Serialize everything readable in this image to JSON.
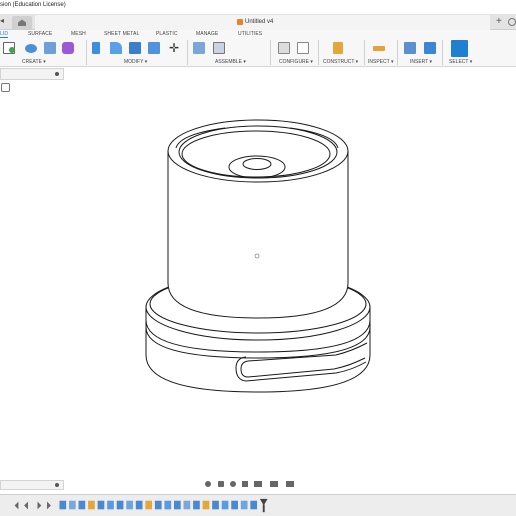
{
  "app": {
    "title": "sion (Education License)",
    "document_title": "Untitled v4"
  },
  "ribbon": {
    "tabs": [
      {
        "label": "LID",
        "active": true
      },
      {
        "label": "SURFACE",
        "active": false
      },
      {
        "label": "MESH",
        "active": false
      },
      {
        "label": "SHEET METAL",
        "active": false
      },
      {
        "label": "PLASTIC",
        "active": false
      },
      {
        "label": "MANAGE",
        "active": false
      },
      {
        "label": "UTILITIES",
        "active": false
      }
    ],
    "groups": [
      {
        "label": "CREATE ▾"
      },
      {
        "label": "MODIFY ▾"
      },
      {
        "label": "ASSEMBLE ▾"
      },
      {
        "label": "CONFIGURE ▾"
      },
      {
        "label": "CONSTRUCT ▾"
      },
      {
        "label": "INSPECT ▾"
      },
      {
        "label": "INSERT ▾"
      },
      {
        "label": "SELECT ▾"
      }
    ]
  },
  "colors": {
    "accent": "#1f7fd1",
    "doc_icon": "#e8822b",
    "ribbon_bg": "#f7f7f7",
    "model_stroke": "#1a1a1a"
  },
  "icons": {
    "home": "home-icon",
    "add_tab": "plus-icon",
    "cube": "cube-icon"
  }
}
